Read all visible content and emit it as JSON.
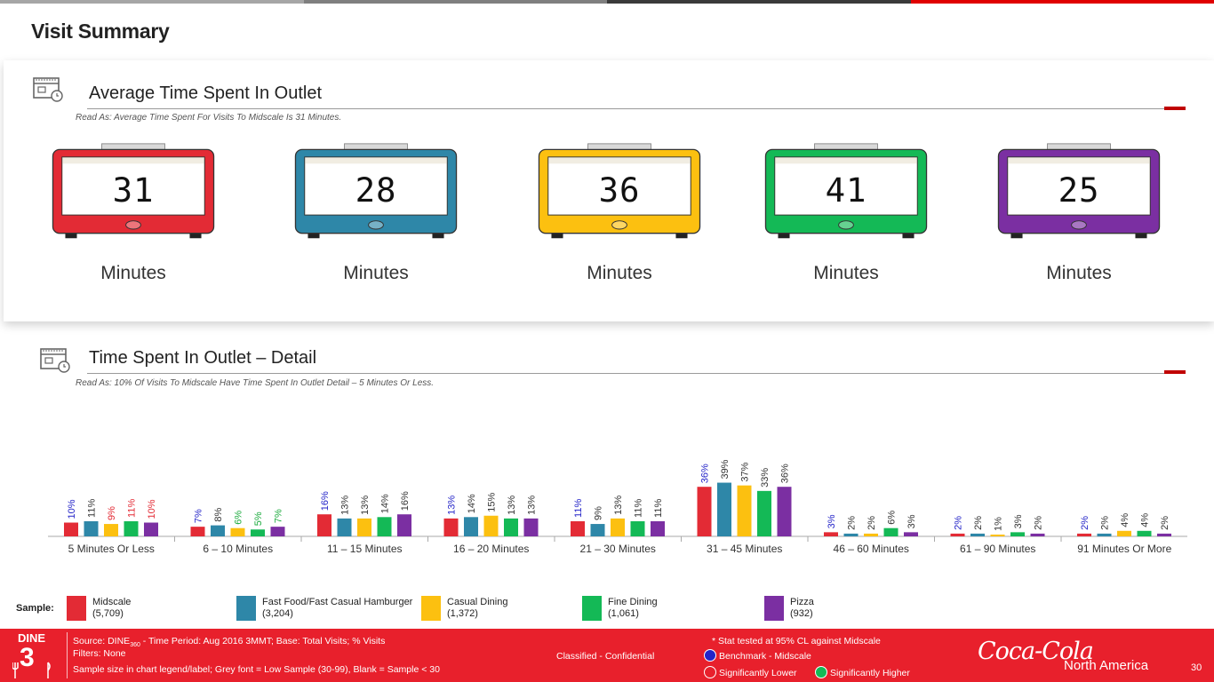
{
  "page": {
    "title": "Visit Summary"
  },
  "colors": {
    "midscale": "#e32b35",
    "hamburger": "#2e87a8",
    "casual": "#fcc010",
    "fine": "#14b956",
    "pizza": "#7b2fa2",
    "benchmark_text": "#2424c8",
    "higher_text": "#1aaa3c",
    "lower_text": "#e32b35",
    "normal_text": "#333333",
    "footer_bg": "#e8202c"
  },
  "section1": {
    "title": "Average Time Spent In Outlet",
    "read_as": "Read As: Average Time Spent For Visits To Midscale Is 31 Minutes.",
    "timers": [
      {
        "value": "31",
        "unit": "Minutes",
        "color": "#e32b35"
      },
      {
        "value": "28",
        "unit": "Minutes",
        "color": "#2e87a8"
      },
      {
        "value": "36",
        "unit": "Minutes",
        "color": "#fcc010"
      },
      {
        "value": "41",
        "unit": "Minutes",
        "color": "#14b956"
      },
      {
        "value": "25",
        "unit": "Minutes",
        "color": "#7b2fa2"
      }
    ]
  },
  "section2": {
    "title": "Time Spent In Outlet – Detail",
    "read_as": "Read As: 10% Of Visits To Midscale Have Time Spent In Outlet Detail – 5 Minutes Or Less."
  },
  "chart_data": {
    "type": "bar",
    "categories": [
      "5 Minutes Or Less",
      "6 – 10 Minutes",
      "11 – 15 Minutes",
      "16 – 20 Minutes",
      "21 – 30 Minutes",
      "31 – 45 Minutes",
      "46 – 60 Minutes",
      "61 – 90 Minutes",
      "91 Minutes Or More"
    ],
    "ylim": [
      0,
      40
    ],
    "series": [
      {
        "name": "Midscale",
        "color": "#e32b35",
        "values": [
          10,
          7,
          16,
          13,
          11,
          36,
          3,
          2,
          2
        ],
        "stat": [
          "b",
          "b",
          "b",
          "b",
          "b",
          "b",
          "b",
          "b",
          "b"
        ]
      },
      {
        "name": "Fast Food/Fast Casual Hamburger",
        "color": "#2e87a8",
        "values": [
          11,
          8,
          13,
          14,
          9,
          39,
          2,
          2,
          2
        ],
        "stat": [
          "n",
          "n",
          "n",
          "n",
          "n",
          "n",
          "n",
          "n",
          "n"
        ]
      },
      {
        "name": "Casual Dining",
        "color": "#fcc010",
        "values": [
          9,
          6,
          13,
          15,
          13,
          37,
          2,
          1,
          4
        ],
        "stat": [
          "l",
          "h",
          "n",
          "n",
          "n",
          "n",
          "n",
          "n",
          "n"
        ]
      },
      {
        "name": "Fine Dining",
        "color": "#14b956",
        "values": [
          11,
          5,
          14,
          13,
          11,
          33,
          6,
          3,
          4
        ],
        "stat": [
          "l",
          "h",
          "n",
          "n",
          "n",
          "n",
          "n",
          "n",
          "n"
        ]
      },
      {
        "name": "Pizza",
        "color": "#7b2fa2",
        "values": [
          10,
          7,
          16,
          13,
          11,
          36,
          3,
          2,
          2
        ],
        "stat": [
          "l",
          "h",
          "n",
          "n",
          "n",
          "n",
          "n",
          "n",
          "n"
        ]
      }
    ]
  },
  "legend": {
    "sample_label": "Sample:",
    "items": [
      {
        "name": "Midscale",
        "n": "(5,709)",
        "color": "#e32b35"
      },
      {
        "name": "Fast Food/Fast Casual Hamburger",
        "n": "(3,204)",
        "color": "#2e87a8"
      },
      {
        "name": "Casual Dining",
        "n": "(1,372)",
        "color": "#fcc010"
      },
      {
        "name": "Fine Dining",
        "n": "(1,061)",
        "color": "#14b956"
      },
      {
        "name": "Pizza",
        "n": "(932)",
        "color": "#7b2fa2"
      }
    ]
  },
  "footer": {
    "logo_text": "DINE",
    "logo_num": "3",
    "source_prefix": "Source: DINE",
    "source_sub": "360",
    "source_suffix": " - Time Period: Aug 2016 3MMT; Base: Total Visits; % Visits",
    "filters": "Filters: None",
    "sample_note": "Sample size in chart legend/label;  Grey font = Low Sample (30-99), Blank = Sample < 30",
    "classified": "Classified - Confidential",
    "stat_note": "* Stat tested at 95% CL against Midscale",
    "benchmark": "Benchmark - Midscale",
    "lower": "Significantly Lower",
    "higher": "Significantly Higher",
    "brand": "Coca-Cola",
    "region": "North America",
    "page_num": "30"
  }
}
